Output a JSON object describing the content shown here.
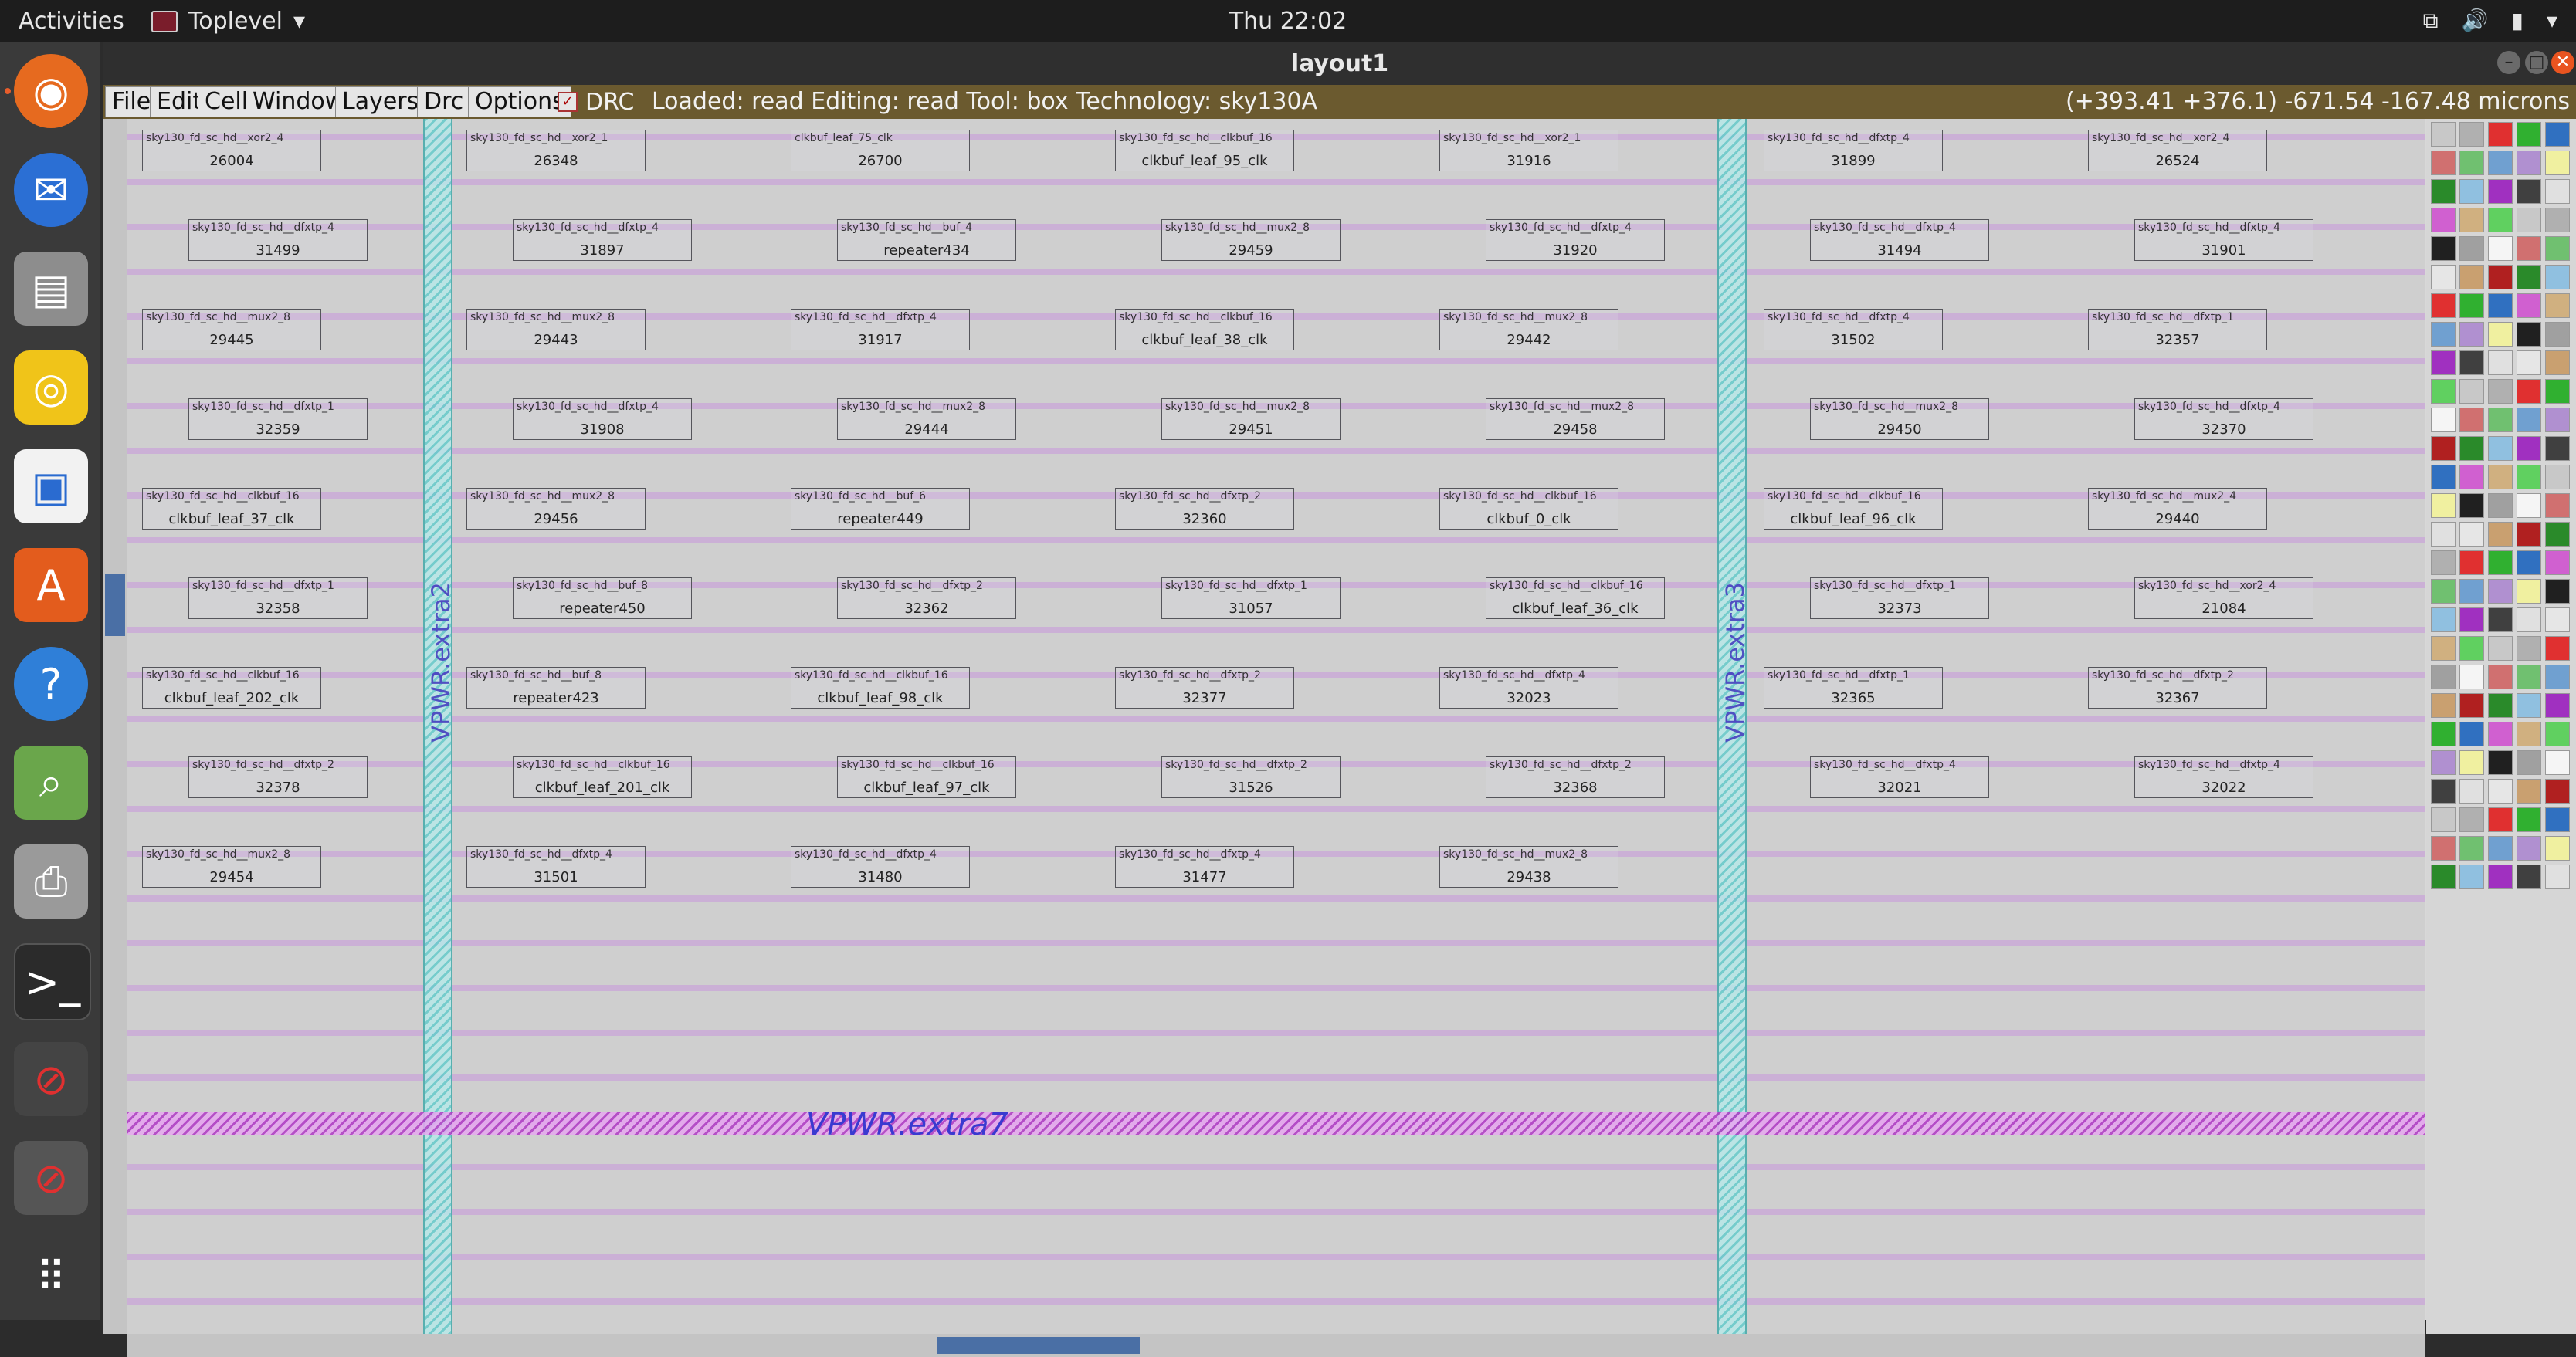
{
  "topbar": {
    "activities": "Activities",
    "app_name": "Toplevel",
    "clock": "Thu 22:02"
  },
  "dock": {
    "items": [
      "firefox-icon",
      "thunderbird-icon",
      "files-icon",
      "rhythmbox-icon",
      "libreoffice-impress-icon",
      "software-center-icon",
      "help-icon",
      "image-viewer-icon",
      "scanner-icon",
      "terminal-icon",
      "blocked-app-icon",
      "blocked-app-icon"
    ]
  },
  "window": {
    "title": "layout1",
    "menus": [
      "File",
      "Edit",
      "Cell",
      "Window",
      "Layers",
      "Drc",
      "Options"
    ],
    "drc_label": "DRC",
    "status": "Loaded: read  Editing: read  Tool: box   Technology: sky130A",
    "coords": "(+393.41 +376.1) -671.54 -167.48 microns"
  },
  "canvas": {
    "vpwr_label": "VPWR.extra7",
    "vstrap_labels": [
      "VPWR.extra2",
      "VPWR.extra3"
    ],
    "cells": [
      {
        "n": "sky130_fd_sc_hd__xor2_4",
        "i": "26004"
      },
      {
        "n": "sky130_fd_sc_hd__xor2_1",
        "i": "26348"
      },
      {
        "n": "clkbuf_leaf_75_clk",
        "i": "26700"
      },
      {
        "n": "sky130_fd_sc_hd__clkbuf_16",
        "i": "clkbuf_leaf_95_clk"
      },
      {
        "n": "sky130_fd_sc_hd__xor2_1",
        "i": "31916"
      },
      {
        "n": "sky130_fd_sc_hd__dfxtp_4",
        "i": "31899"
      },
      {
        "n": "sky130_fd_sc_hd__xor2_4",
        "i": "26524"
      },
      {
        "n": "sky130_fd_sc_hd__dfxtp_4",
        "i": "31499"
      },
      {
        "n": "sky130_fd_sc_hd__dfxtp_4",
        "i": "31897"
      },
      {
        "n": "sky130_fd_sc_hd__buf_4",
        "i": "repeater434"
      },
      {
        "n": "sky130_fd_sc_hd__mux2_8",
        "i": "29459"
      },
      {
        "n": "sky130_fd_sc_hd__dfxtp_4",
        "i": "31920"
      },
      {
        "n": "sky130_fd_sc_hd__dfxtp_4",
        "i": "31494"
      },
      {
        "n": "sky130_fd_sc_hd__dfxtp_4",
        "i": "31901"
      },
      {
        "n": "sky130_fd_sc_hd__mux2_8",
        "i": "29445"
      },
      {
        "n": "sky130_fd_sc_hd__mux2_8",
        "i": "29443"
      },
      {
        "n": "sky130_fd_sc_hd__dfxtp_4",
        "i": "31917"
      },
      {
        "n": "sky130_fd_sc_hd__clkbuf_16",
        "i": "clkbuf_leaf_38_clk"
      },
      {
        "n": "sky130_fd_sc_hd__mux2_8",
        "i": "29442"
      },
      {
        "n": "sky130_fd_sc_hd__dfxtp_4",
        "i": "31502"
      },
      {
        "n": "sky130_fd_sc_hd__dfxtp_1",
        "i": "32357"
      },
      {
        "n": "sky130_fd_sc_hd__dfxtp_1",
        "i": "32359"
      },
      {
        "n": "sky130_fd_sc_hd__dfxtp_4",
        "i": "31908"
      },
      {
        "n": "sky130_fd_sc_hd__mux2_8",
        "i": "29444"
      },
      {
        "n": "sky130_fd_sc_hd__mux2_8",
        "i": "29451"
      },
      {
        "n": "sky130_fd_sc_hd__mux2_8",
        "i": "29458"
      },
      {
        "n": "sky130_fd_sc_hd__mux2_8",
        "i": "29450"
      },
      {
        "n": "sky130_fd_sc_hd__dfxtp_4",
        "i": "32370"
      },
      {
        "n": "sky130_fd_sc_hd__clkbuf_16",
        "i": "clkbuf_leaf_37_clk"
      },
      {
        "n": "sky130_fd_sc_hd__mux2_8",
        "i": "29456"
      },
      {
        "n": "sky130_fd_sc_hd__buf_6",
        "i": "repeater449"
      },
      {
        "n": "sky130_fd_sc_hd__dfxtp_2",
        "i": "32360"
      },
      {
        "n": "sky130_fd_sc_hd__clkbuf_16",
        "i": "clkbuf_0_clk"
      },
      {
        "n": "sky130_fd_sc_hd__clkbuf_16",
        "i": "clkbuf_leaf_96_clk"
      },
      {
        "n": "sky130_fd_sc_hd__mux2_4",
        "i": "29440"
      },
      {
        "n": "sky130_fd_sc_hd__dfxtp_1",
        "i": "32358"
      },
      {
        "n": "sky130_fd_sc_hd__buf_8",
        "i": "repeater450"
      },
      {
        "n": "sky130_fd_sc_hd__dfxtp_2",
        "i": "32362"
      },
      {
        "n": "sky130_fd_sc_hd__dfxtp_1",
        "i": "31057"
      },
      {
        "n": "sky130_fd_sc_hd__clkbuf_16",
        "i": "clkbuf_leaf_36_clk"
      },
      {
        "n": "sky130_fd_sc_hd__dfxtp_1",
        "i": "32373"
      },
      {
        "n": "sky130_fd_sc_hd__xor2_4",
        "i": "21084"
      },
      {
        "n": "sky130_fd_sc_hd__clkbuf_16",
        "i": "clkbuf_leaf_202_clk"
      },
      {
        "n": "sky130_fd_sc_hd__buf_8",
        "i": "repeater423"
      },
      {
        "n": "sky130_fd_sc_hd__clkbuf_16",
        "i": "clkbuf_leaf_98_clk"
      },
      {
        "n": "sky130_fd_sc_hd__dfxtp_2",
        "i": "32377"
      },
      {
        "n": "sky130_fd_sc_hd__dfxtp_4",
        "i": "32023"
      },
      {
        "n": "sky130_fd_sc_hd__dfxtp_1",
        "i": "32365"
      },
      {
        "n": "sky130_fd_sc_hd__dfxtp_2",
        "i": "32367"
      },
      {
        "n": "sky130_fd_sc_hd__dfxtp_2",
        "i": "32378"
      },
      {
        "n": "sky130_fd_sc_hd__clkbuf_16",
        "i": "clkbuf_leaf_201_clk"
      },
      {
        "n": "sky130_fd_sc_hd__clkbuf_16",
        "i": "clkbuf_leaf_97_clk"
      },
      {
        "n": "sky130_fd_sc_hd__dfxtp_2",
        "i": "31526"
      },
      {
        "n": "sky130_fd_sc_hd__dfxtp_2",
        "i": "32368"
      },
      {
        "n": "sky130_fd_sc_hd__dfxtp_4",
        "i": "32021"
      },
      {
        "n": "sky130_fd_sc_hd__dfxtp_4",
        "i": "32022"
      },
      {
        "n": "sky130_fd_sc_hd__mux2_8",
        "i": "29454"
      },
      {
        "n": "sky130_fd_sc_hd__dfxtp_4",
        "i": "31501"
      },
      {
        "n": "sky130_fd_sc_hd__dfxtp_4",
        "i": "31480"
      },
      {
        "n": "sky130_fd_sc_hd__dfxtp_4",
        "i": "31477"
      },
      {
        "n": "sky130_fd_sc_hd__mux2_8",
        "i": "29438"
      }
    ]
  }
}
